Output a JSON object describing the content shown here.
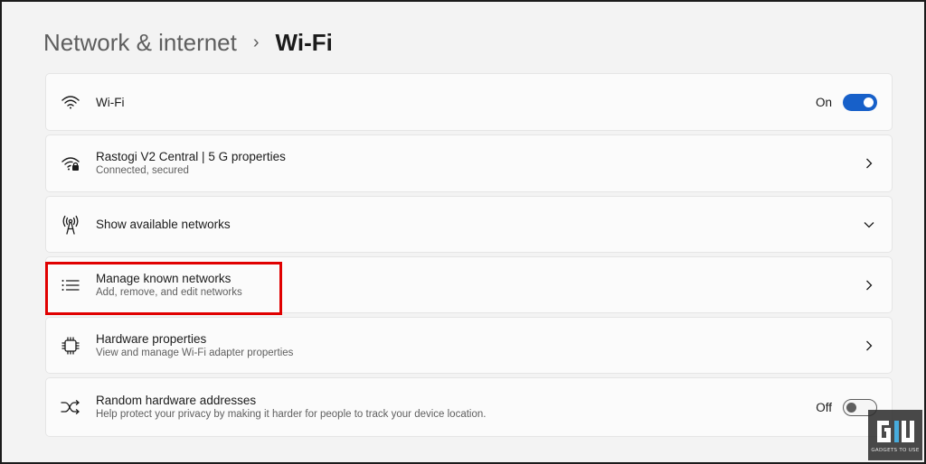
{
  "breadcrumb": {
    "parent": "Network & internet",
    "separator": "›",
    "current": "Wi-Fi"
  },
  "rows": [
    {
      "name": "wifi",
      "icon": "wifi-icon",
      "title": "Wi-Fi",
      "subtitle": "",
      "control": "toggle",
      "state_label": "On",
      "state": true
    },
    {
      "name": "network",
      "icon": "wifi-secure-icon",
      "title": "Rastogi V2 Central |  5 G properties",
      "subtitle": "Connected, secured",
      "control": "chevron-right"
    },
    {
      "name": "show-available",
      "icon": "antenna-icon",
      "title": "Show available networks",
      "subtitle": "",
      "control": "chevron-down"
    },
    {
      "name": "manage-known",
      "icon": "list-icon",
      "title": "Manage known networks",
      "subtitle": "Add, remove, and edit networks",
      "control": "chevron-right"
    },
    {
      "name": "hardware-properties",
      "icon": "chip-icon",
      "title": "Hardware properties",
      "subtitle": "View and manage Wi-Fi adapter properties",
      "control": "chevron-right"
    },
    {
      "name": "random-hw-addresses",
      "icon": "shuffle-icon",
      "title": "Random hardware addresses",
      "subtitle": "Help protect your privacy by making it harder for people to track your device location.",
      "control": "toggle",
      "state_label": "Off",
      "state": false
    }
  ],
  "watermark": {
    "text": "GADGETS TO USE"
  },
  "colors": {
    "accent": "#1760c9",
    "highlight": "#e00000",
    "background": "#f3f3f3",
    "card": "#fbfbfb"
  }
}
